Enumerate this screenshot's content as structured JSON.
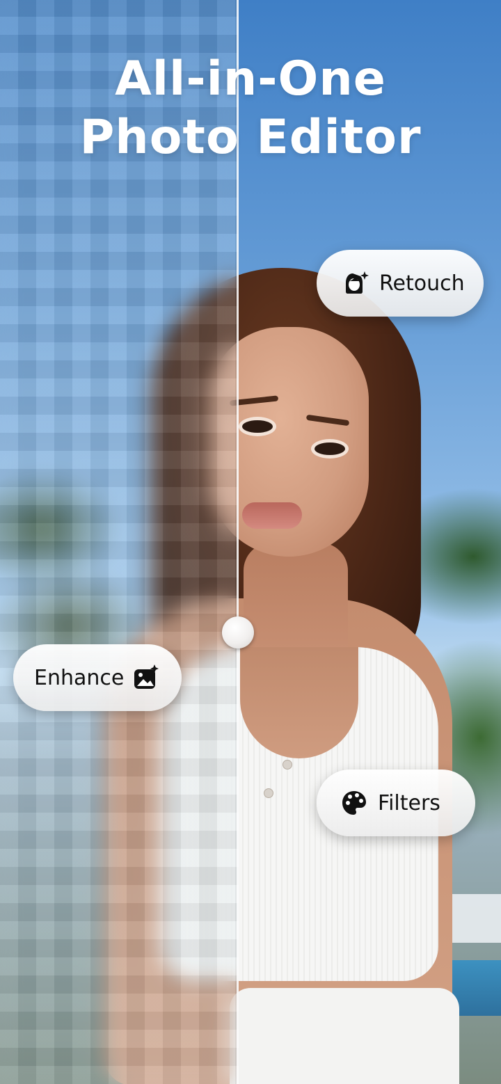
{
  "title": {
    "line1": "All-in-One",
    "line2": "Photo Editor"
  },
  "features": {
    "retouch": {
      "label": "Retouch",
      "icon": "face-sparkle-icon"
    },
    "enhance": {
      "label": "Enhance",
      "icon": "image-sparkle-icon"
    },
    "filters": {
      "label": "Filters",
      "icon": "palette-icon"
    }
  },
  "compare_slider": {
    "icon": "slider-handle"
  },
  "colors": {
    "text_on_photo": "#ffffff",
    "pill_background": "#f2f2f2",
    "pill_text": "#111111"
  }
}
